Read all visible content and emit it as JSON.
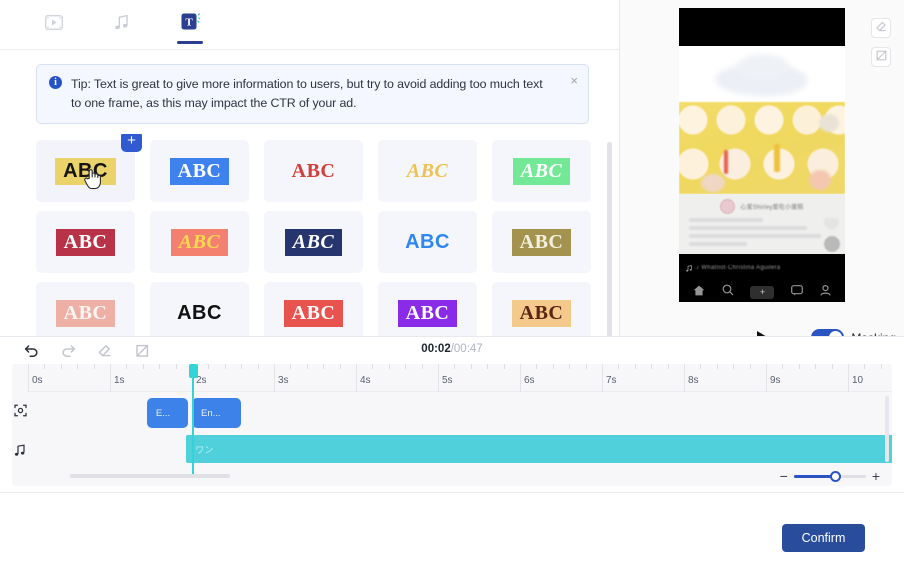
{
  "tabs": [
    {
      "id": "video",
      "icon": "video-icon",
      "label": "Video",
      "active": false
    },
    {
      "id": "music",
      "icon": "music-note-icon",
      "label": "Music",
      "active": false
    },
    {
      "id": "text",
      "icon": "text-t-icon",
      "label": "Text",
      "active": true
    }
  ],
  "tip": {
    "icon": "info-icon",
    "text": "Tip: Text is great to give more information to users, but try to avoid adding too much text to one frame, as this may impact the CTR of your ad.",
    "close_label": "×"
  },
  "text_styles": {
    "sample_label": "ABC",
    "add_badge_label": "+",
    "items": [
      {
        "name": "style-gold-black",
        "bg": "#ead36a",
        "fg": "#141414",
        "weight": 800,
        "italic": false,
        "serif": false,
        "selected": true
      },
      {
        "name": "style-blue-white",
        "bg": "#3d82ef",
        "fg": "#ffffff",
        "weight": 800,
        "italic": false,
        "serif": true,
        "selected": false
      },
      {
        "name": "style-white-red",
        "bg": "#ffffff",
        "fg": "#d2403c",
        "weight": 800,
        "italic": false,
        "serif": true,
        "selected": false
      },
      {
        "name": "style-white-gold",
        "bg": "#fdfdfb",
        "fg": "#ecc253",
        "weight": 700,
        "italic": true,
        "serif": true,
        "selected": false
      },
      {
        "name": "style-green-white",
        "bg": "#73e896",
        "fg": "#ffffff",
        "weight": 700,
        "italic": true,
        "serif": true,
        "selected": false
      },
      {
        "name": "style-crimson-white",
        "bg": "#b83347",
        "fg": "#ffffff",
        "weight": 800,
        "italic": false,
        "serif": true,
        "selected": false
      },
      {
        "name": "style-salmon-yellow",
        "bg": "#f4816f",
        "fg": "#f7d851",
        "weight": 800,
        "italic": true,
        "serif": true,
        "selected": false
      },
      {
        "name": "style-navy-white",
        "bg": "#26356e",
        "fg": "#ffffff",
        "weight": 800,
        "italic": true,
        "serif": true,
        "selected": false
      },
      {
        "name": "style-white-brightblue",
        "bg": "#fdfdff",
        "fg": "#2f87f0",
        "weight": 800,
        "italic": false,
        "serif": false,
        "selected": false
      },
      {
        "name": "style-olive-cream",
        "bg": "#a3934e",
        "fg": "#f4efdd",
        "weight": 800,
        "italic": false,
        "serif": true,
        "selected": false
      },
      {
        "name": "style-pink-white",
        "bg": "#eeb0a5",
        "fg": "#fdf5f3",
        "weight": 700,
        "italic": false,
        "serif": true,
        "selected": false
      },
      {
        "name": "style-white-black",
        "bg": "#ffffff",
        "fg": "#111111",
        "weight": 800,
        "italic": false,
        "serif": false,
        "selected": false
      },
      {
        "name": "style-red-white",
        "bg": "#e8534f",
        "fg": "#ffffff",
        "weight": 800,
        "italic": false,
        "serif": true,
        "selected": false
      },
      {
        "name": "style-purple-white",
        "bg": "#8b2bea",
        "fg": "#ffffff",
        "weight": 800,
        "italic": false,
        "serif": true,
        "selected": false
      },
      {
        "name": "style-peach-brown",
        "bg": "#f3c98c",
        "fg": "#5d2414",
        "weight": 800,
        "italic": false,
        "serif": true,
        "selected": false
      }
    ]
  },
  "preview": {
    "tools": [
      {
        "name": "eraser-tool-button",
        "icon": "eraser-icon"
      },
      {
        "name": "crop-tool-button",
        "icon": "crop-icon"
      }
    ],
    "play_label": "▶",
    "masking_label": "Masking",
    "masking_on": true,
    "phone": {
      "account_name": "心爱Shirley爱吃小蛋糕",
      "music_text": "♪ Whatnot·Christina Aguilera",
      "nav_items": [
        "home-icon",
        "search-icon",
        "plus-icon",
        "inbox-icon",
        "profile-icon"
      ]
    }
  },
  "timeline": {
    "toolbar": [
      {
        "name": "undo-button",
        "icon": "undo-icon",
        "enabled": true
      },
      {
        "name": "redo-button",
        "icon": "redo-icon",
        "enabled": false
      },
      {
        "name": "eraser-button",
        "icon": "eraser-icon",
        "enabled": false
      },
      {
        "name": "crop-button",
        "icon": "crop-icon",
        "enabled": false
      }
    ],
    "current_time": "00:02",
    "total_time": "/00:47",
    "ruler_labels": [
      "0s",
      "1s",
      "2s",
      "3s",
      "4s",
      "5s",
      "6s",
      "7s",
      "8s",
      "9s",
      "10"
    ],
    "playhead_time": "2s",
    "tracks": [
      {
        "name": "text-track",
        "icon": "text-element-icon",
        "clips": [
          {
            "name": "text-clip-1",
            "label": "E...",
            "start_s": 1.45,
            "end_s": 1.95
          },
          {
            "name": "text-clip-2",
            "label": "En...",
            "start_s": 2.0,
            "end_s": 2.6
          }
        ]
      },
      {
        "name": "audio-track",
        "icon": "music-note-icon",
        "clips": [
          {
            "name": "audio-clip-1",
            "label": "ワン",
            "start_s": 1.93,
            "end_s": 11.0
          }
        ]
      }
    ],
    "zoom": {
      "minus": "−",
      "plus": "+",
      "value": 50
    }
  },
  "footer": {
    "confirm_label": "Confirm"
  },
  "colors": {
    "accent_blue": "#2a53c4",
    "confirm_blue": "#2a4d9b",
    "timeline_cyan": "#4fd0da",
    "clip_blue": "#3d82e8",
    "playhead": "#34d4d6"
  }
}
